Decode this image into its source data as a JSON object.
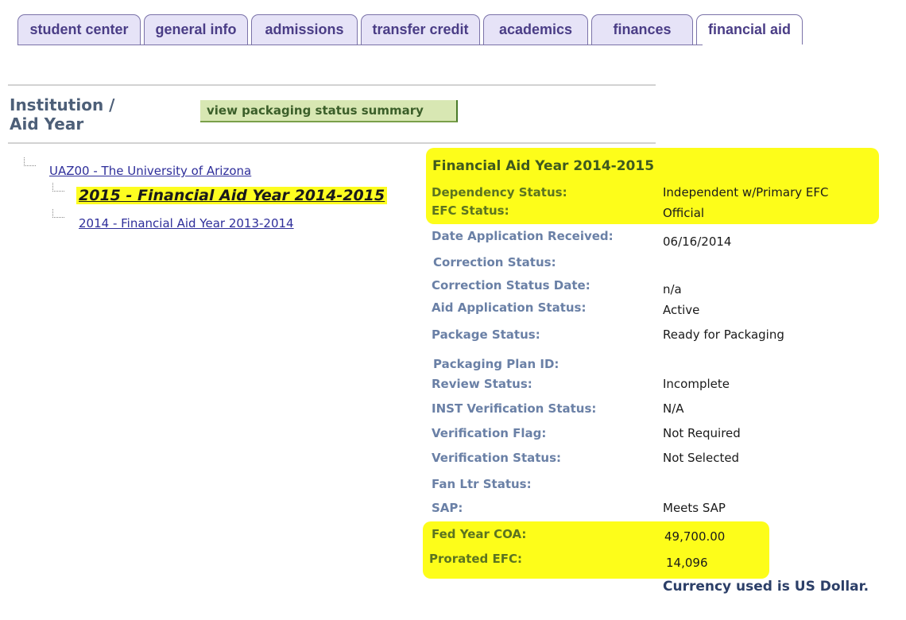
{
  "tabs": [
    {
      "label": "student center"
    },
    {
      "label": "general info"
    },
    {
      "label": "admissions"
    },
    {
      "label": "transfer credit"
    },
    {
      "label": "academics"
    },
    {
      "label": "finances"
    },
    {
      "label": "financial aid",
      "active": true
    }
  ],
  "section": {
    "title_line1": "Institution /",
    "title_line2": "Aid Year",
    "summary_button": "view packaging status summary"
  },
  "tree": {
    "institution": "UAZ00 - The University of Arizona",
    "aid_years": [
      {
        "label": "2015 - Financial Aid Year 2014-2015",
        "selected": true
      },
      {
        "label": "2014 - Financial Aid Year 2013-2014",
        "selected": false
      }
    ]
  },
  "details": {
    "title": "Financial Aid Year 2014-2015",
    "fields": [
      {
        "label": "Dependency Status:",
        "value": "Independent w/Primary EFC"
      },
      {
        "label": "EFC Status:",
        "value": "Official"
      },
      {
        "label": "Date Application Received:",
        "value": "06/16/2014"
      },
      {
        "label": "Correction Status:",
        "value": ""
      },
      {
        "label": "Correction Status Date:",
        "value": "n/a"
      },
      {
        "label": "Aid Application Status:",
        "value": "Active"
      },
      {
        "label": "Package Status:",
        "value": "Ready for Packaging"
      },
      {
        "label": "Packaging Plan ID:",
        "value": ""
      },
      {
        "label": "Review Status:",
        "value": "Incomplete"
      },
      {
        "label": "INST Verification Status:",
        "value": "N/A"
      },
      {
        "label": "Verification Flag:",
        "value": "Not Required"
      },
      {
        "label": "Verification Status:",
        "value": "Not Selected"
      },
      {
        "label": "Fan Ltr Status:",
        "value": ""
      },
      {
        "label": "SAP:",
        "value": "Meets SAP"
      },
      {
        "label": "Fed Year COA:",
        "value": "49,700.00"
      },
      {
        "label": "Prorated EFC:",
        "value": "14,096"
      }
    ],
    "currency_note": "Currency used is US Dollar."
  },
  "colors": {
    "highlight": "#fdfd1a",
    "tab_border": "#7a72a8",
    "tab_bg": "#e6e3f7",
    "label_blue": "#6a80a6",
    "label_green": "#5c7420",
    "link": "#2e2e9a"
  }
}
